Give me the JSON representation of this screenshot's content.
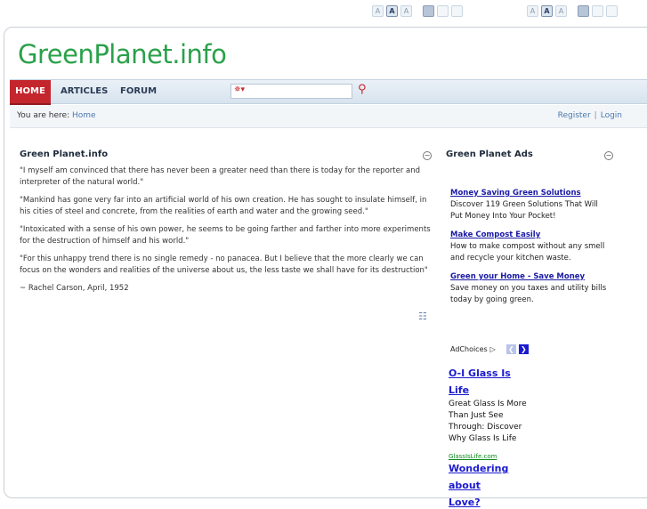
{
  "font_controls": {
    "a_small": "A",
    "a_medium": "A",
    "a_large": "A"
  },
  "site": {
    "title": "GreenPlanet.info"
  },
  "nav": {
    "items": [
      {
        "label": "HOME"
      },
      {
        "label": "ARTICLES"
      },
      {
        "label": "FORUM"
      }
    ]
  },
  "search": {
    "value": ""
  },
  "breadcrumb": {
    "label": "You are here:",
    "home": "Home",
    "register": "Register",
    "separator": "|",
    "login": "Login"
  },
  "main": {
    "title": "Green Planet.info",
    "paragraphs": [
      "\"I myself am convinced that there has never been a greater need than there is today for the reporter and interpreter of the natural world.\"",
      "\"Mankind has gone very far into an artificial world of his own creation.  He has sought to insulate himself, in his cities of steel and concrete, from the realities of earth and water and the growing seed.\"",
      "\"Intoxicated with a sense of his own power, he seems to be going farther and farther into more experiments for the destruction of himself and his world.\"",
      "\"For this unhappy trend there is no single remedy - no panacea. But I believe that the more clearly we can focus on the wonders and realities of the universe about us, the less taste we shall have for its destruction\"",
      "~ Rachel Carson, April, 1952"
    ]
  },
  "sidebar": {
    "title": "Green Planet Ads",
    "ads": [
      {
        "title": "Money Saving Green Solutions ",
        "text": "Discover 119 Green Solutions That Will Put Money Into Your Pocket!"
      },
      {
        "title": "Make Compost Easily ",
        "text": "How to make compost without any smell and recycle your kitchen waste."
      },
      {
        "title": "Green your Home - Save Money ",
        "text": "Save money on you taxes and utility bills today by going green."
      }
    ],
    "adchoices": "AdChoices",
    "google_ads": [
      {
        "title": "O-I Glass Is Life",
        "text": "Great Glass Is More Than Just See Through: Discover Why Glass Is Life",
        "url": "GlassIsLife.com"
      },
      {
        "title": "Wondering about Love?",
        "text": "",
        "url": ""
      }
    ]
  },
  "colors": {
    "logo_green": "#2aa14a",
    "nav_active_red": "#c4262e",
    "link_blue": "#4a78b0",
    "ad_link_blue": "#1a1ad0"
  },
  "icons": {
    "toggle": "minus-circle-icon",
    "search_go": "magnifier-icon",
    "rss": "feed-icon"
  }
}
